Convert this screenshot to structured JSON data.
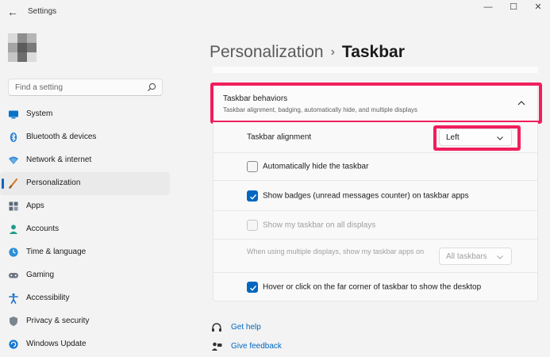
{
  "window": {
    "title": "Settings",
    "back_glyph": "←",
    "minimize_glyph": "—",
    "maximize_glyph": "☐",
    "close_glyph": "✕"
  },
  "search": {
    "placeholder": "Find a setting"
  },
  "sidebar": {
    "items": [
      {
        "label": "System",
        "icon": "monitor-icon"
      },
      {
        "label": "Bluetooth & devices",
        "icon": "bluetooth-icon"
      },
      {
        "label": "Network & internet",
        "icon": "wifi-icon"
      },
      {
        "label": "Personalization",
        "icon": "brush-icon",
        "active": true
      },
      {
        "label": "Apps",
        "icon": "apps-icon"
      },
      {
        "label": "Accounts",
        "icon": "person-icon"
      },
      {
        "label": "Time & language",
        "icon": "globe-clock-icon"
      },
      {
        "label": "Gaming",
        "icon": "gamepad-icon"
      },
      {
        "label": "Accessibility",
        "icon": "accessibility-icon"
      },
      {
        "label": "Privacy & security",
        "icon": "shield-icon"
      },
      {
        "label": "Windows Update",
        "icon": "update-icon"
      }
    ]
  },
  "breadcrumb": {
    "parent": "Personalization",
    "separator": "›",
    "current": "Taskbar"
  },
  "group": {
    "title": "Taskbar behaviors",
    "subtitle": "Taskbar alignment, badging, automatically hide, and multiple displays",
    "expanded": true
  },
  "settings": {
    "alignment": {
      "label": "Taskbar alignment",
      "value": "Left"
    },
    "auto_hide": {
      "label": "Automatically hide the taskbar",
      "checked": false
    },
    "badges": {
      "label": "Show badges (unread messages counter) on taskbar apps",
      "checked": true
    },
    "all_displays": {
      "label": "Show my taskbar on all displays",
      "checked": false,
      "disabled": true
    },
    "multi_display": {
      "label": "When using multiple displays, show my taskbar apps on",
      "value": "All taskbars",
      "disabled": true
    },
    "far_corner": {
      "label": "Hover or click on the far corner of taskbar to show the desktop",
      "checked": true
    }
  },
  "links": {
    "help": "Get help",
    "feedback": "Give feedback"
  },
  "colors": {
    "accent": "#0067c0",
    "highlight": "#f01f5c"
  }
}
